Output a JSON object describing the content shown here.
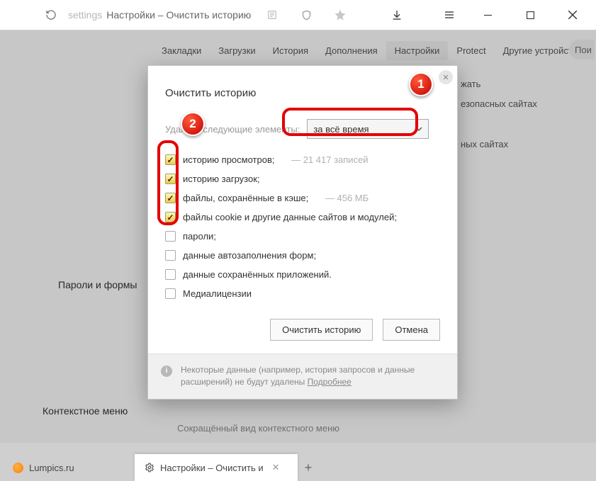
{
  "titlebar": {
    "addr_prefix": "settings",
    "addr_title": "Настройки – Очистить историю"
  },
  "tabs": {
    "items": [
      "Закладки",
      "Загрузки",
      "История",
      "Дополнения",
      "Настройки",
      "Protect",
      "Другие устройства"
    ],
    "active_index": 4,
    "search_hint": "Пои"
  },
  "side": {
    "pwd_forms": "Пароли и формы",
    "ctx_menu": "Контекстное меню"
  },
  "bg": {
    "line1": "жать",
    "line2": "езопасных сайтах",
    "line3": "ных сайтах",
    "line4": "Сокращённый вид контекстного меню"
  },
  "dialog": {
    "title": "Очистить историю",
    "range_label": "Удалить следующие элементы:",
    "range_value": "за всё время",
    "options": [
      {
        "checked": true,
        "label": "историю просмотров;",
        "sub": "—  21 417 записей"
      },
      {
        "checked": true,
        "label": "историю загрузок;",
        "sub": ""
      },
      {
        "checked": true,
        "label": "файлы, сохранённые в кэше;",
        "sub": "—  456 МБ"
      },
      {
        "checked": true,
        "label": "файлы cookie и другие данные сайтов и модулей;",
        "sub": ""
      },
      {
        "checked": false,
        "label": "пароли;",
        "sub": ""
      },
      {
        "checked": false,
        "label": "данные автозаполнения форм;",
        "sub": ""
      },
      {
        "checked": false,
        "label": "данные сохранённых приложений.",
        "sub": ""
      },
      {
        "checked": false,
        "label": "Медиалицензии",
        "sub": ""
      }
    ],
    "btn_clear": "Очистить историю",
    "btn_cancel": "Отмена",
    "footer_text": "Некоторые данные (например, история запросов и данные расширений) не будут удалены ",
    "footer_link": "Подробнее"
  },
  "annotations": {
    "badge1": "1",
    "badge2": "2"
  },
  "bottombar": {
    "tab1": "Lumpics.ru",
    "tab2": "Настройки – Очистить и"
  }
}
